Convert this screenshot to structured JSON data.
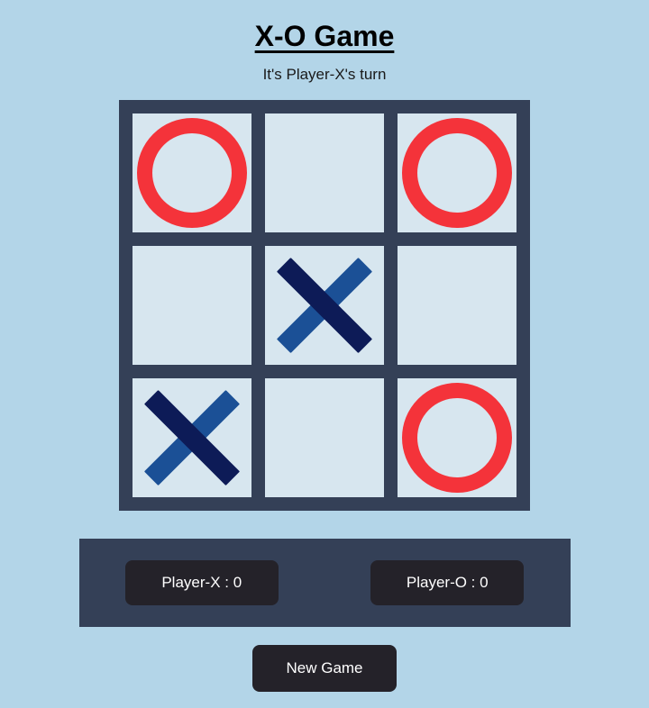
{
  "header": {
    "title": "X-O Game",
    "status": "It's Player-X's turn"
  },
  "board": {
    "cells": [
      {
        "index": 0,
        "mark": "O",
        "name": "cell-0-0"
      },
      {
        "index": 1,
        "mark": "",
        "name": "cell-0-1"
      },
      {
        "index": 2,
        "mark": "O",
        "name": "cell-0-2"
      },
      {
        "index": 3,
        "mark": "",
        "name": "cell-1-0"
      },
      {
        "index": 4,
        "mark": "X",
        "name": "cell-1-1"
      },
      {
        "index": 5,
        "mark": "",
        "name": "cell-1-2"
      },
      {
        "index": 6,
        "mark": "X",
        "name": "cell-2-0"
      },
      {
        "index": 7,
        "mark": "",
        "name": "cell-2-1"
      },
      {
        "index": 8,
        "mark": "O",
        "name": "cell-2-2"
      }
    ]
  },
  "scoreboard": {
    "player_x_label": "Player-X : 0",
    "player_o_label": "Player-O : 0"
  },
  "controls": {
    "new_game_label": "New Game"
  },
  "colors": {
    "page_background": "#b3d5e8",
    "board_frame": "#344057",
    "cell_background": "#d7e6ef",
    "o_mark": "#f4333a",
    "x_mark_dark": "#0d1b57",
    "x_mark_light": "#1b5096",
    "button_background": "#242229",
    "button_text": "#ffffff",
    "title_text": "#000000"
  }
}
